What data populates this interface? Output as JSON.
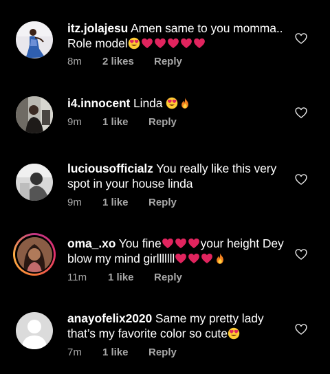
{
  "comments": [
    {
      "username": "itz.jolajesu",
      "text_parts": [
        "Amen same to you momma.. Role model"
      ],
      "time": "8m",
      "likes": "2 likes",
      "reply": "Reply"
    },
    {
      "username": "i4.innocent",
      "text_parts": [
        "Linda "
      ],
      "time": "9m",
      "likes": "1 like",
      "reply": "Reply"
    },
    {
      "username": "luciousofficialz",
      "text_parts": [
        "You really like this very spot in your house linda"
      ],
      "time": "9m",
      "likes": "1 like",
      "reply": "Reply"
    },
    {
      "username": "oma_.xo",
      "text_parts": [
        "You fine",
        "your height Dey blow my mind girlllllll"
      ],
      "time": "11m",
      "likes": "1 like",
      "reply": "Reply"
    },
    {
      "username": "anayofelix2020",
      "text_parts": [
        "Same my pretty lady that’s my favorite color so cute"
      ],
      "time": "7m",
      "likes": "1 like",
      "reply": "Reply"
    }
  ],
  "icons": {
    "like": "heart-outline-icon",
    "heart_emoji": "red-heart-emoji",
    "heart_eyes_emoji": "heart-eyes-emoji",
    "fire_emoji": "fire-emoji"
  },
  "colors": {
    "background": "#000000",
    "text": "#ffffff",
    "meta": "#a8a8a8",
    "heart": "#e0245e"
  }
}
